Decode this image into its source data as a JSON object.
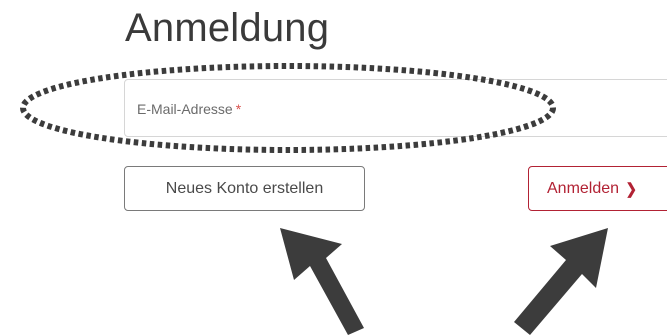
{
  "header": {
    "title": "Anmeldung"
  },
  "form": {
    "email_label": "E-Mail-Adresse",
    "required_marker": "*"
  },
  "actions": {
    "create_account_label": "Neues Konto erstellen",
    "login_label": "Anmelden",
    "login_icon": "chevron-right-icon"
  },
  "annotations": {
    "highlight_icon": "dotted-ellipse",
    "pointer_icon": "arrow-icon"
  },
  "colors": {
    "brand_red": "#b22234",
    "required_star": "#d9534f",
    "annotation_dark": "#3c3c3c"
  }
}
